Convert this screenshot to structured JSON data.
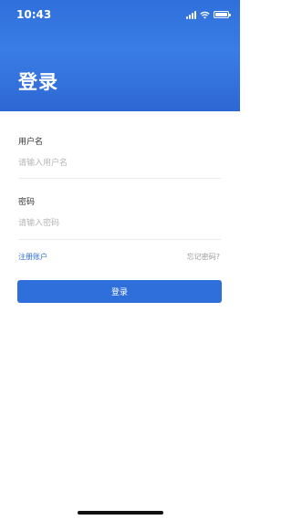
{
  "status_bar": {
    "time": "10:43"
  },
  "header": {
    "title": "登录"
  },
  "form": {
    "username_label": "用户名",
    "username_placeholder": "请输入用户名",
    "password_label": "密码",
    "password_placeholder": "请输入密码"
  },
  "links": {
    "register": "注册账户",
    "forgot_password": "忘记密码?"
  },
  "login_button": {
    "label": "登录"
  },
  "colors": {
    "primary": "#2f6fdb",
    "header_gradient_light": "#3a7de6"
  },
  "icons": [
    "cellular-signal-icon",
    "wifi-icon",
    "battery-icon"
  ]
}
